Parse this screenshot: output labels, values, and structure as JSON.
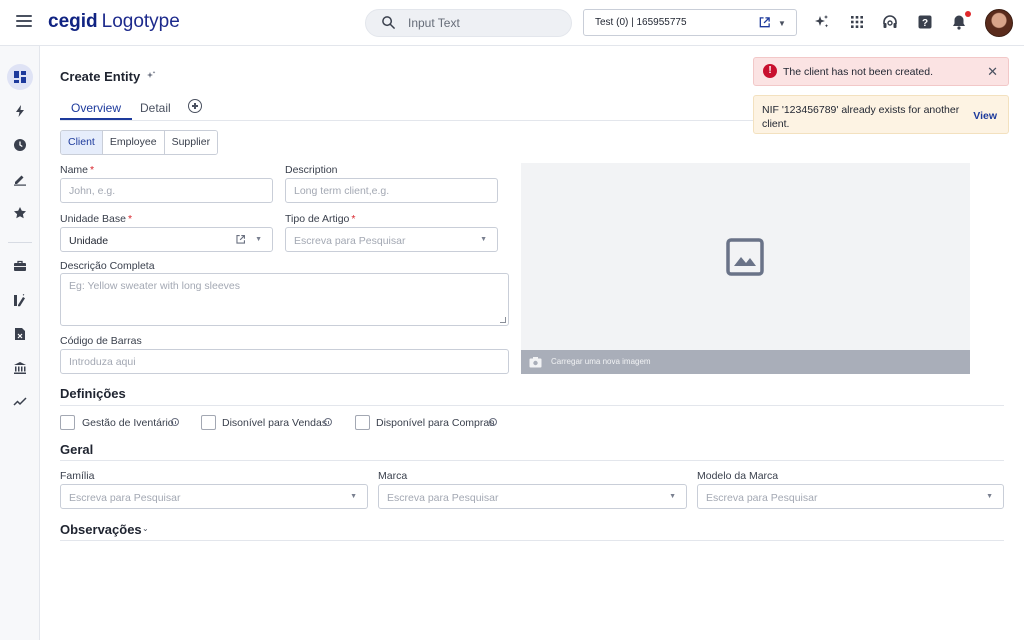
{
  "topbar": {
    "logo_brand": "cegid",
    "logo_rest": "Logotype",
    "search_placeholder": "Input Text",
    "company_selector": "Test (0) | 165955775"
  },
  "page": {
    "title": "Create Entity",
    "tabs": [
      {
        "label": "Overview",
        "active": true
      },
      {
        "label": "Detail",
        "active": false
      }
    ],
    "entity_types": [
      {
        "label": "Client",
        "active": true
      },
      {
        "label": "Employee",
        "active": false
      },
      {
        "label": "Supplier",
        "active": false
      }
    ]
  },
  "form": {
    "name_label": "Name",
    "name_required": "*",
    "name_placeholder": "John, e.g.",
    "description_label": "Description",
    "description_placeholder": "Long term client,e.g.",
    "unidade_base_label": "Unidade Base",
    "unidade_base_required": "*",
    "unidade_base_value": "Unidade",
    "tipo_artigo_label": "Tipo de Artigo",
    "tipo_artigo_required": "*",
    "tipo_artigo_placeholder": "Escreva para Pesquisar",
    "descricao_completa_label": "Descrição Completa",
    "descricao_completa_placeholder": "Eg: Yellow sweater with long sleeves",
    "codigo_barras_label": "Código de Barras",
    "codigo_barras_placeholder": "Introduza aqui",
    "image_upload_label": "Carregar uma nova imagem"
  },
  "definicoes": {
    "title": "Definições",
    "options": [
      {
        "label": "Gestão de Iventário",
        "checked": false
      },
      {
        "label": "Disonível para Vendas",
        "checked": false
      },
      {
        "label": "Disponível para Compras",
        "checked": false
      }
    ]
  },
  "geral": {
    "title": "Geral",
    "familia_label": "Família",
    "familia_placeholder": "Escreva para Pesquisar",
    "marca_label": "Marca",
    "marca_placeholder": "Escreva para Pesquisar",
    "modelo_label": "Modelo da Marca",
    "modelo_placeholder": "Escreva para Pesquisar"
  },
  "observacoes": {
    "title": "Observações"
  },
  "toasts": {
    "error_message": "The client has not been created.",
    "warning_message": "NIF '123456789' already exists for another client.",
    "warning_link": "View"
  },
  "colors": {
    "brand": "#102382",
    "accent": "#1d3a9c",
    "error": "#c8102e",
    "notification_dot": "#e0282c"
  }
}
